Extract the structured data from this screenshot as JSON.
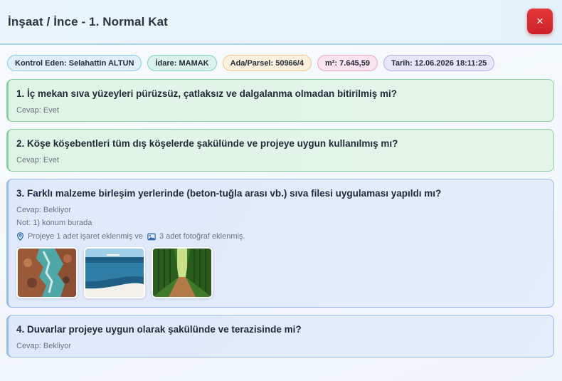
{
  "header": {
    "title": "İnşaat / İnce - 1. Normal Kat",
    "close_label": "×"
  },
  "badges": {
    "inspector": "Kontrol Eden: Selahattin ALTUN",
    "admin": "İdare: MAMAK",
    "parcel": "Ada/Parsel: 50966/4",
    "area": "m²: 7.645,59",
    "date": "Tarih: 12.06.2026 18:11:25"
  },
  "questions": [
    {
      "text": "1. İç mekan sıva yüzeyleri pürüzsüz, çatlaksız ve dalgalanma olmadan bitirilmiş mi?",
      "answer": "Cevap: Evet",
      "status_color": "#8fd0a3"
    },
    {
      "text": "2. Köşe köşebentleri tüm dış köşelerde şakülünde ve projeye uygun kullanılmış mı?",
      "answer": "Cevap: Evet",
      "status_color": "#8fd0a3"
    },
    {
      "text": "3. Farklı malzeme birleşim yerlerinde (beton-tuğla arası vb.) sıva filesi uygulaması yapıldı mı?",
      "answer": "Cevap: Bekliyor",
      "note": "Not: 1) konum burada",
      "marker_info": "Projeye 1 adet işaret eklenmiş ve",
      "photo_info": "3 adet fotoğraf eklenmiş.",
      "photos": [
        "photo-1",
        "photo-2",
        "photo-3"
      ],
      "status_color": "#9ab9ec"
    },
    {
      "text": "4. Duvarlar projeye uygun olarak şakülünde ve terazisinde mi?",
      "answer": "Cevap: Bekliyor",
      "status_color": "#9ab9ec"
    }
  ],
  "icons": {
    "marker": "map-pin-icon",
    "photo": "image-icon",
    "close": "close-icon"
  },
  "colors": {
    "close_button": "#d9292e",
    "header_border": "#a9d8ee"
  }
}
